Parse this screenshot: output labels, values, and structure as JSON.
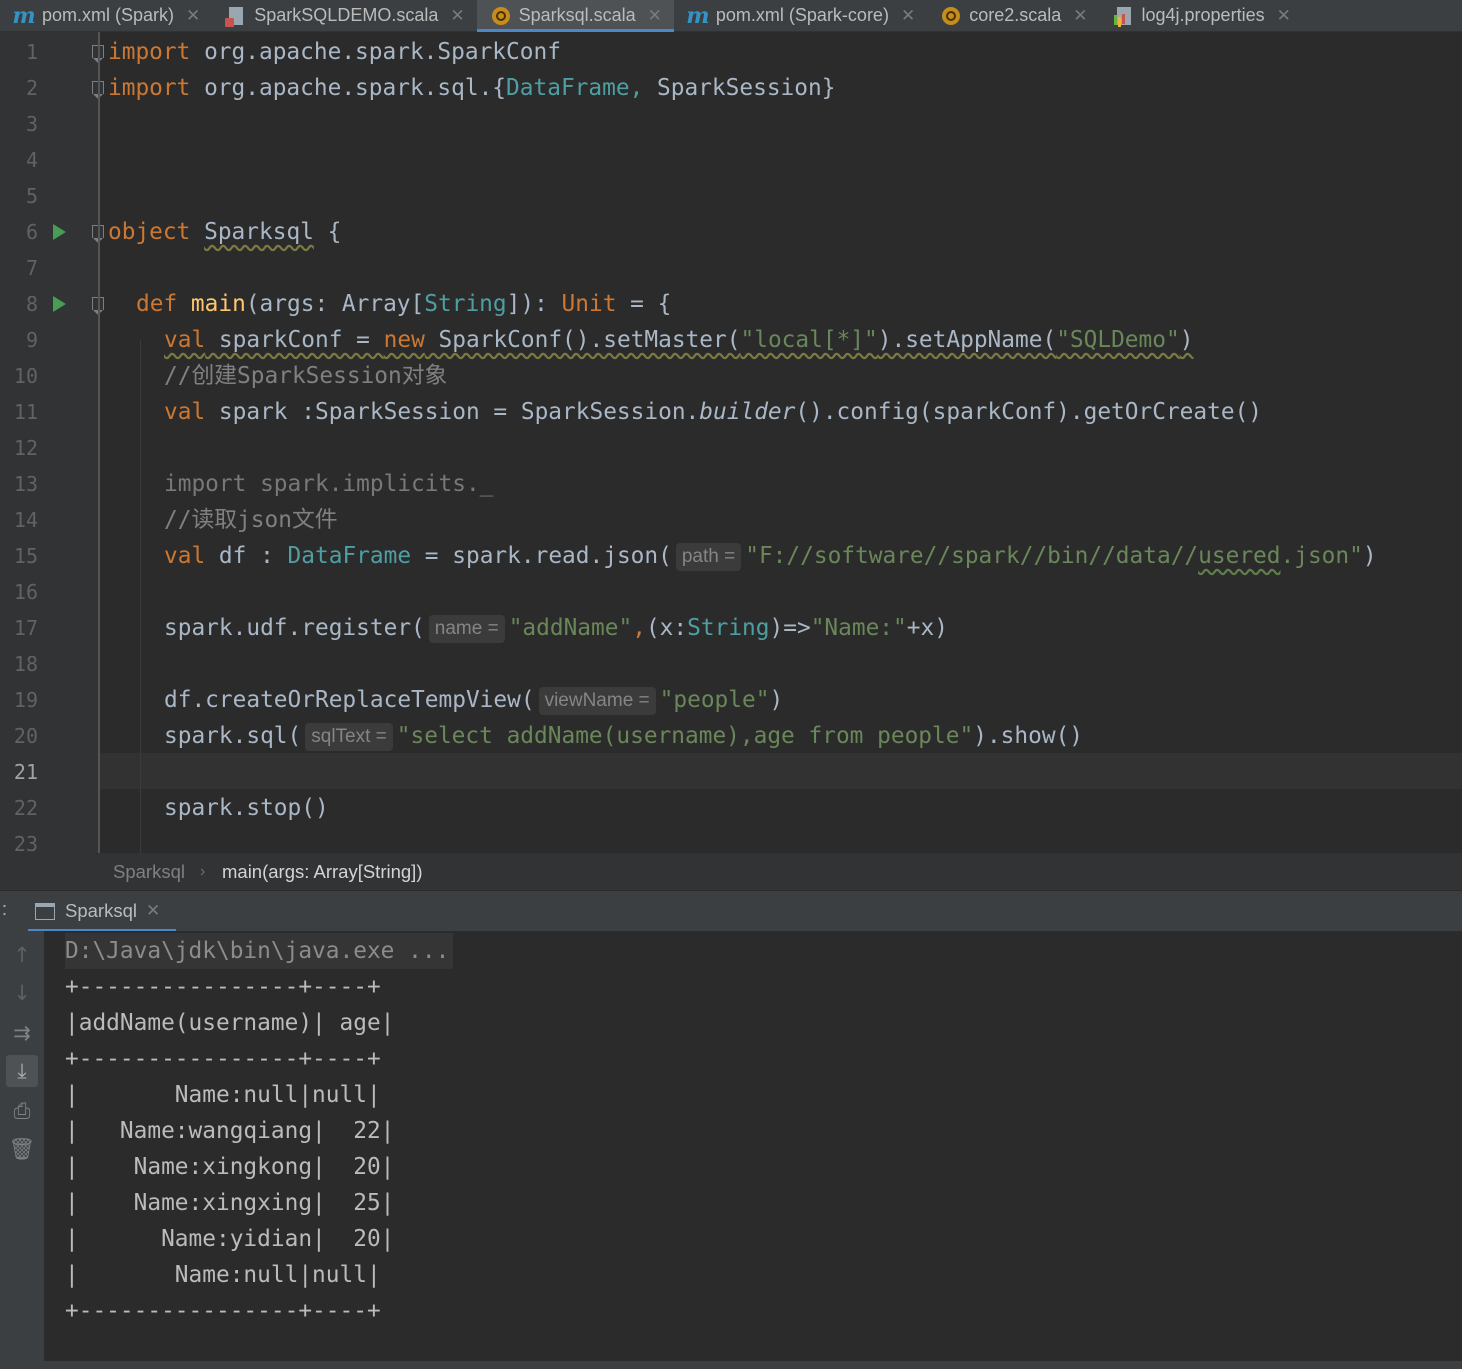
{
  "tabs": [
    {
      "icon": "maven-m-icon",
      "label": "pom.xml (Spark)",
      "active": false
    },
    {
      "icon": "scala-file-icon",
      "label": "SparkSQLDEMO.scala",
      "active": false
    },
    {
      "icon": "scala-object-icon",
      "label": "Sparksql.scala",
      "active": true
    },
    {
      "icon": "maven-m-icon",
      "label": "pom.xml (Spark-core)",
      "active": false
    },
    {
      "icon": "scala-object-icon",
      "label": "core2.scala",
      "active": false
    },
    {
      "icon": "properties-file-icon",
      "label": "log4j.properties",
      "active": false
    }
  ],
  "editor": {
    "line_numbers": [
      "1",
      "2",
      "3",
      "4",
      "5",
      "6",
      "7",
      "8",
      "9",
      "10",
      "11",
      "12",
      "13",
      "14",
      "15",
      "16",
      "17",
      "18",
      "19",
      "20",
      "21",
      "22",
      "23"
    ],
    "current_line": "21",
    "code": {
      "l1": {
        "kw": "import",
        "rest": " org.apache.spark.SparkConf"
      },
      "l2": {
        "kw": "import",
        "a": " org.apache.spark.sql.{",
        "ty": "DataFrame,",
        "b": " SparkSession}"
      },
      "l6": {
        "kw": "object",
        "sp": " ",
        "name": "Sparksql",
        "b": " {"
      },
      "l8": {
        "kw": "def",
        "sp1": " ",
        "fn": "main",
        "a": "(args: Array[",
        "ty": "String",
        "b": "]): ",
        "kw2": "Unit",
        "c": " = {"
      },
      "l9": {
        "kw": "val",
        "a": " sparkConf = ",
        "kw2": "new",
        "b": " SparkConf().setMaster(",
        "s1": "\"local[*]\"",
        "c": ").setAppName(",
        "s2": "\"SQLDemo\"",
        "d": ")"
      },
      "l10": {
        "comment": "//创建SparkSession对象"
      },
      "l11": {
        "kw": "val",
        "a": " spark :SparkSession = SparkSession.",
        "it": "builder",
        "b": "().config(sparkConf).getOrCreate()"
      },
      "l13": {
        "text": "import spark.implicits._"
      },
      "l14": {
        "comment": "//读取json文件"
      },
      "l15": {
        "kw": "val",
        "a": " df : ",
        "ty": "DataFrame",
        "b": " = spark.read.json(",
        "hint": "path =",
        "s1": "\"F://software//spark//bin//data//",
        "s2": "usered",
        "s3": ".json\"",
        "c": ")"
      },
      "l17": {
        "a": "spark.udf.register(",
        "hint": "name =",
        "s1": "\"addName\"",
        "k": ",",
        "b": "(x:",
        "ty": "String",
        "c": ")=>",
        "s2": "\"Name:\"",
        "d": "+x)"
      },
      "l19": {
        "a": "df.createOrReplaceTempView(",
        "hint": "viewName =",
        "s1": "\"people\"",
        "b": ")"
      },
      "l20": {
        "a": "spark.sql(",
        "hint": "sqlText =",
        "s1": "\"select addName(username),age from people\"",
        "b": ").show()"
      },
      "l22": {
        "a": "spark.stop()"
      }
    }
  },
  "breadcrumb": {
    "object": "Sparksql",
    "method": "main(args: Array[String])"
  },
  "run_panel": {
    "dots": ":",
    "tab_label": "Sparksql",
    "output": [
      "D:\\Java\\jdk\\bin\\java.exe ...",
      "+----------------+----+",
      "|addName(username)| age|",
      "+----------------+----+",
      "|       Name:null|null|",
      "|   Name:wangqiang|  22|",
      "|    Name:xingkong|  20|",
      "|    Name:xingxing|  25|",
      "|      Name:yidian|  20|",
      "|       Name:null|null|",
      "+----------------+----+"
    ],
    "toolbar": [
      "up-arrow-icon",
      "down-arrow-icon",
      "soft-wrap-icon",
      "scroll-to-end-icon",
      "print-icon",
      "trash-icon"
    ]
  },
  "colors": {
    "keyword": "#cc7832",
    "string": "#6a8759",
    "type": "#4e9fa3",
    "comment": "#808080",
    "function": "#ffc66d",
    "accent": "#4a88c7",
    "run": "#499c54"
  }
}
